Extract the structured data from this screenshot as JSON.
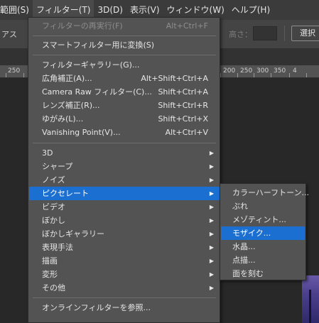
{
  "menubar": {
    "items": [
      {
        "label": "範囲(S)"
      },
      {
        "label": "フィルター(T)"
      },
      {
        "label": "3D(D)"
      },
      {
        "label": "表示(V)"
      },
      {
        "label": "ウィンドウ(W)"
      },
      {
        "label": "ヘルプ(H)"
      }
    ]
  },
  "optionsbar": {
    "left_label": "アス",
    "height_label": "高さ：",
    "select_button": "選択"
  },
  "ruler": {
    "labels": [
      "250",
      "200",
      "250",
      "300",
      "350",
      "4"
    ]
  },
  "filter_menu": {
    "items": [
      {
        "label": "フィルターの再実行(F)",
        "shortcut": "Alt+Ctrl+F",
        "disabled": true
      },
      {
        "label": "スマートフィルター用に変換(S)",
        "shortcut": ""
      },
      {
        "label": "フィルターギャラリー(G)...",
        "shortcut": ""
      },
      {
        "label": "広角補正(A)...",
        "shortcut": "Alt+Shift+Ctrl+A"
      },
      {
        "label": "Camera Raw フィルター(C)...",
        "shortcut": "Shift+Ctrl+A"
      },
      {
        "label": "レンズ補正(R)...",
        "shortcut": "Shift+Ctrl+R"
      },
      {
        "label": "ゆがみ(L)...",
        "shortcut": "Shift+Ctrl+X"
      },
      {
        "label": "Vanishing Point(V)...",
        "shortcut": "Alt+Ctrl+V"
      },
      {
        "label": "3D",
        "submenu": true
      },
      {
        "label": "シャープ",
        "submenu": true
      },
      {
        "label": "ノイズ",
        "submenu": true
      },
      {
        "label": "ピクセレート",
        "submenu": true,
        "highlighted": true
      },
      {
        "label": "ビデオ",
        "submenu": true
      },
      {
        "label": "ぼかし",
        "submenu": true
      },
      {
        "label": "ぼかしギャラリー",
        "submenu": true
      },
      {
        "label": "表現手法",
        "submenu": true
      },
      {
        "label": "描画",
        "submenu": true
      },
      {
        "label": "変形",
        "submenu": true
      },
      {
        "label": "その他",
        "submenu": true
      },
      {
        "label": "オンラインフィルターを参照..."
      }
    ]
  },
  "pixelate_submenu": {
    "items": [
      {
        "label": "カラーハーフトーン..."
      },
      {
        "label": "ぶれ"
      },
      {
        "label": "メゾティント..."
      },
      {
        "label": "モザイク...",
        "highlighted": true
      },
      {
        "label": "水晶..."
      },
      {
        "label": "点描..."
      },
      {
        "label": "面を刻む"
      }
    ]
  },
  "colors": {
    "highlight": "#1a6fd0",
    "menu_bg": "#535353",
    "menubar_bg": "#3b3b3b"
  },
  "icons": {
    "submenu_arrow": "submenu-arrow-icon"
  }
}
